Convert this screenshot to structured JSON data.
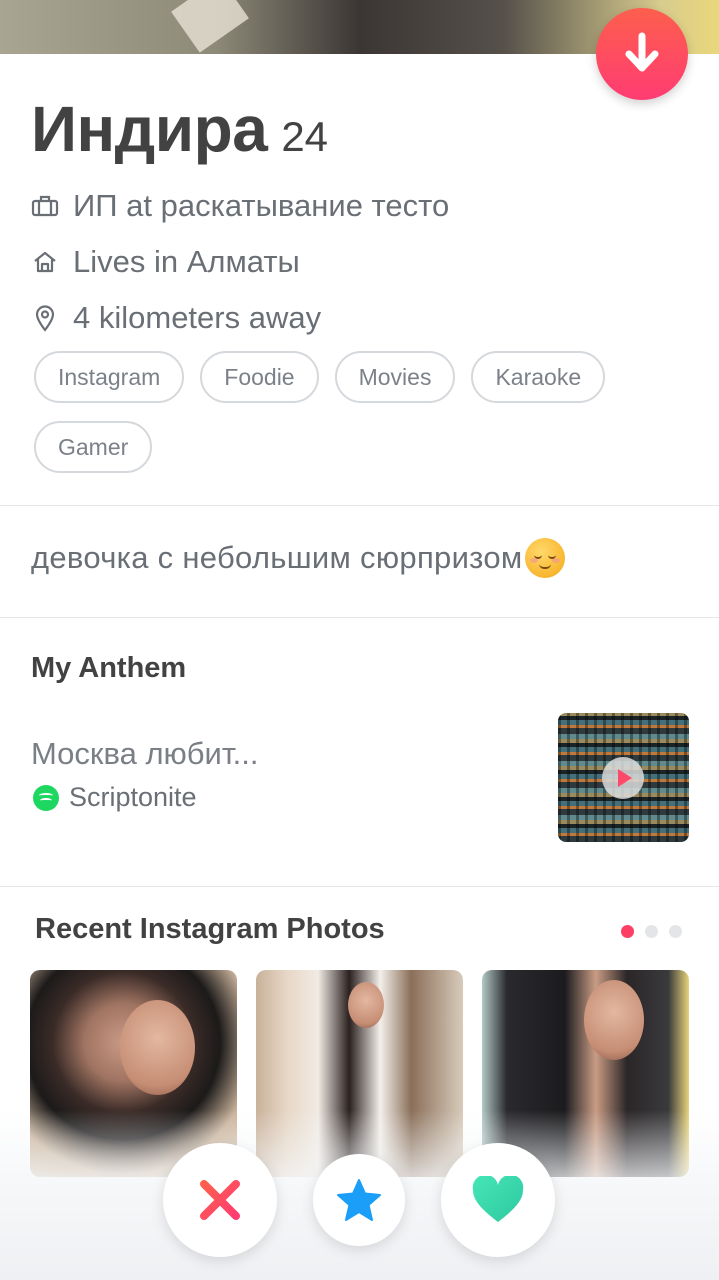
{
  "profile": {
    "name": "Индира",
    "age": "24",
    "job": "ИП at раскатывание тесто",
    "lives": "Lives in Алматы",
    "distance": "4 kilometers away"
  },
  "icons": {
    "job": "briefcase-icon",
    "home": "home-icon",
    "location": "location-pin-icon",
    "collapse": "arrow-down-icon",
    "nope": "x-icon",
    "superlike": "star-icon",
    "like": "heart-icon"
  },
  "interests": [
    "Instagram",
    "Foodie",
    "Movies",
    "Karaoke",
    "Gamer"
  ],
  "bio": "девочка с небольшим сюрпризом",
  "anthem": {
    "title": "My Anthem",
    "song": "Москва любит...",
    "artist": "Scriptonite"
  },
  "instagram": {
    "title": "Recent Instagram Photos",
    "page_count": 3,
    "active_page": 1
  },
  "colors": {
    "accent": "#fe3c72",
    "superlike": "#1a9ef8",
    "like": "#3ce0b0",
    "spotify": "#1ed760"
  }
}
